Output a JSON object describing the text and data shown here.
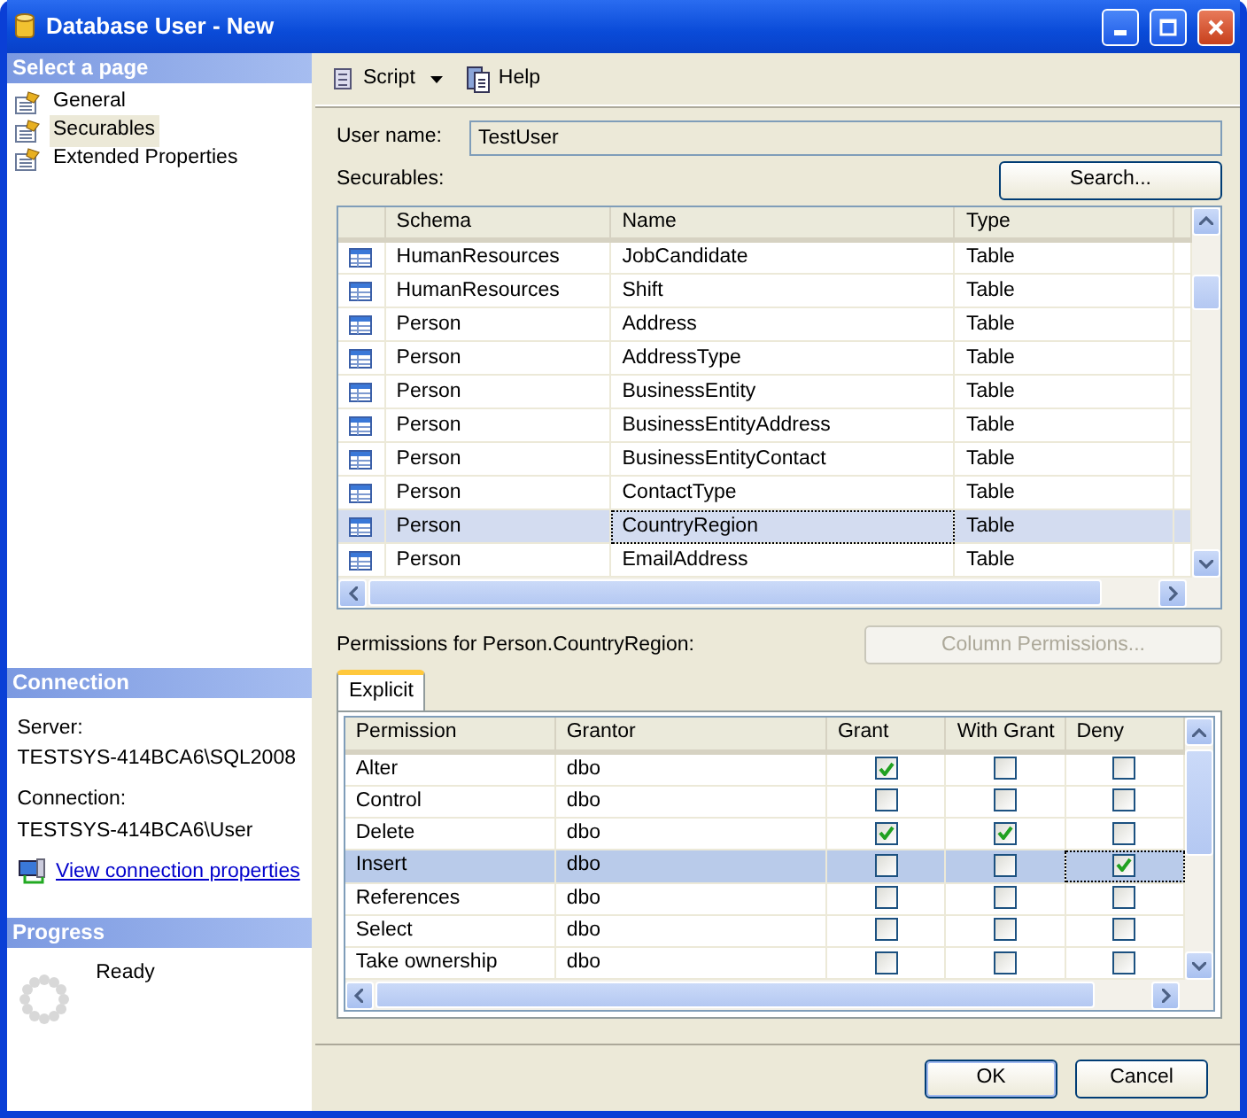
{
  "window": {
    "title": "Database User - New"
  },
  "sidebar": {
    "header": "Select a page",
    "pages": [
      {
        "label": "General",
        "selected": false
      },
      {
        "label": "Securables",
        "selected": true
      },
      {
        "label": "Extended Properties",
        "selected": false
      }
    ],
    "connection": {
      "header": "Connection",
      "server_label": "Server:",
      "server": "TESTSYS-414BCA6\\SQL2008",
      "connection_label": "Connection:",
      "connection": "TESTSYS-414BCA6\\User",
      "link": "View connection properties"
    },
    "progress": {
      "header": "Progress",
      "status": "Ready"
    }
  },
  "toolbar": {
    "script": "Script",
    "help": "Help"
  },
  "user_name": {
    "label": "User name:",
    "value": "TestUser"
  },
  "securables": {
    "label": "Securables:",
    "search_button": "Search...",
    "columns": [
      "Schema",
      "Name",
      "Type"
    ],
    "rows": [
      {
        "schema": "HumanResources",
        "name": "JobCandidate",
        "type": "Table",
        "selected": false
      },
      {
        "schema": "HumanResources",
        "name": "Shift",
        "type": "Table",
        "selected": false
      },
      {
        "schema": "Person",
        "name": "Address",
        "type": "Table",
        "selected": false
      },
      {
        "schema": "Person",
        "name": "AddressType",
        "type": "Table",
        "selected": false
      },
      {
        "schema": "Person",
        "name": "BusinessEntity",
        "type": "Table",
        "selected": false
      },
      {
        "schema": "Person",
        "name": "BusinessEntityAddress",
        "type": "Table",
        "selected": false
      },
      {
        "schema": "Person",
        "name": "BusinessEntityContact",
        "type": "Table",
        "selected": false
      },
      {
        "schema": "Person",
        "name": "ContactType",
        "type": "Table",
        "selected": false
      },
      {
        "schema": "Person",
        "name": "CountryRegion",
        "type": "Table",
        "selected": true
      },
      {
        "schema": "Person",
        "name": "EmailAddress",
        "type": "Table",
        "selected": false
      }
    ]
  },
  "permissions": {
    "label": "Permissions for Person.CountryRegion:",
    "column_permissions_button": {
      "label": "Column Permissions...",
      "disabled": true
    },
    "tabs": [
      {
        "label": "Explicit",
        "selected": true
      }
    ],
    "columns": [
      "Permission",
      "Grantor",
      "Grant",
      "With Grant",
      "Deny"
    ],
    "rows": [
      {
        "permission": "Alter",
        "grantor": "dbo",
        "grant": true,
        "with_grant": false,
        "deny": false,
        "selected": false
      },
      {
        "permission": "Control",
        "grantor": "dbo",
        "grant": false,
        "with_grant": false,
        "deny": false,
        "selected": false
      },
      {
        "permission": "Delete",
        "grantor": "dbo",
        "grant": true,
        "with_grant": true,
        "deny": false,
        "selected": false
      },
      {
        "permission": "Insert",
        "grantor": "dbo",
        "grant": false,
        "with_grant": false,
        "deny": true,
        "selected": true
      },
      {
        "permission": "References",
        "grantor": "dbo",
        "grant": false,
        "with_grant": false,
        "deny": false,
        "selected": false
      },
      {
        "permission": "Select",
        "grantor": "dbo",
        "grant": false,
        "with_grant": false,
        "deny": false,
        "selected": false
      },
      {
        "permission": "Take ownership",
        "grantor": "dbo",
        "grant": false,
        "with_grant": false,
        "deny": false,
        "selected": false
      }
    ]
  },
  "buttons": [
    "OK",
    "Cancel"
  ]
}
